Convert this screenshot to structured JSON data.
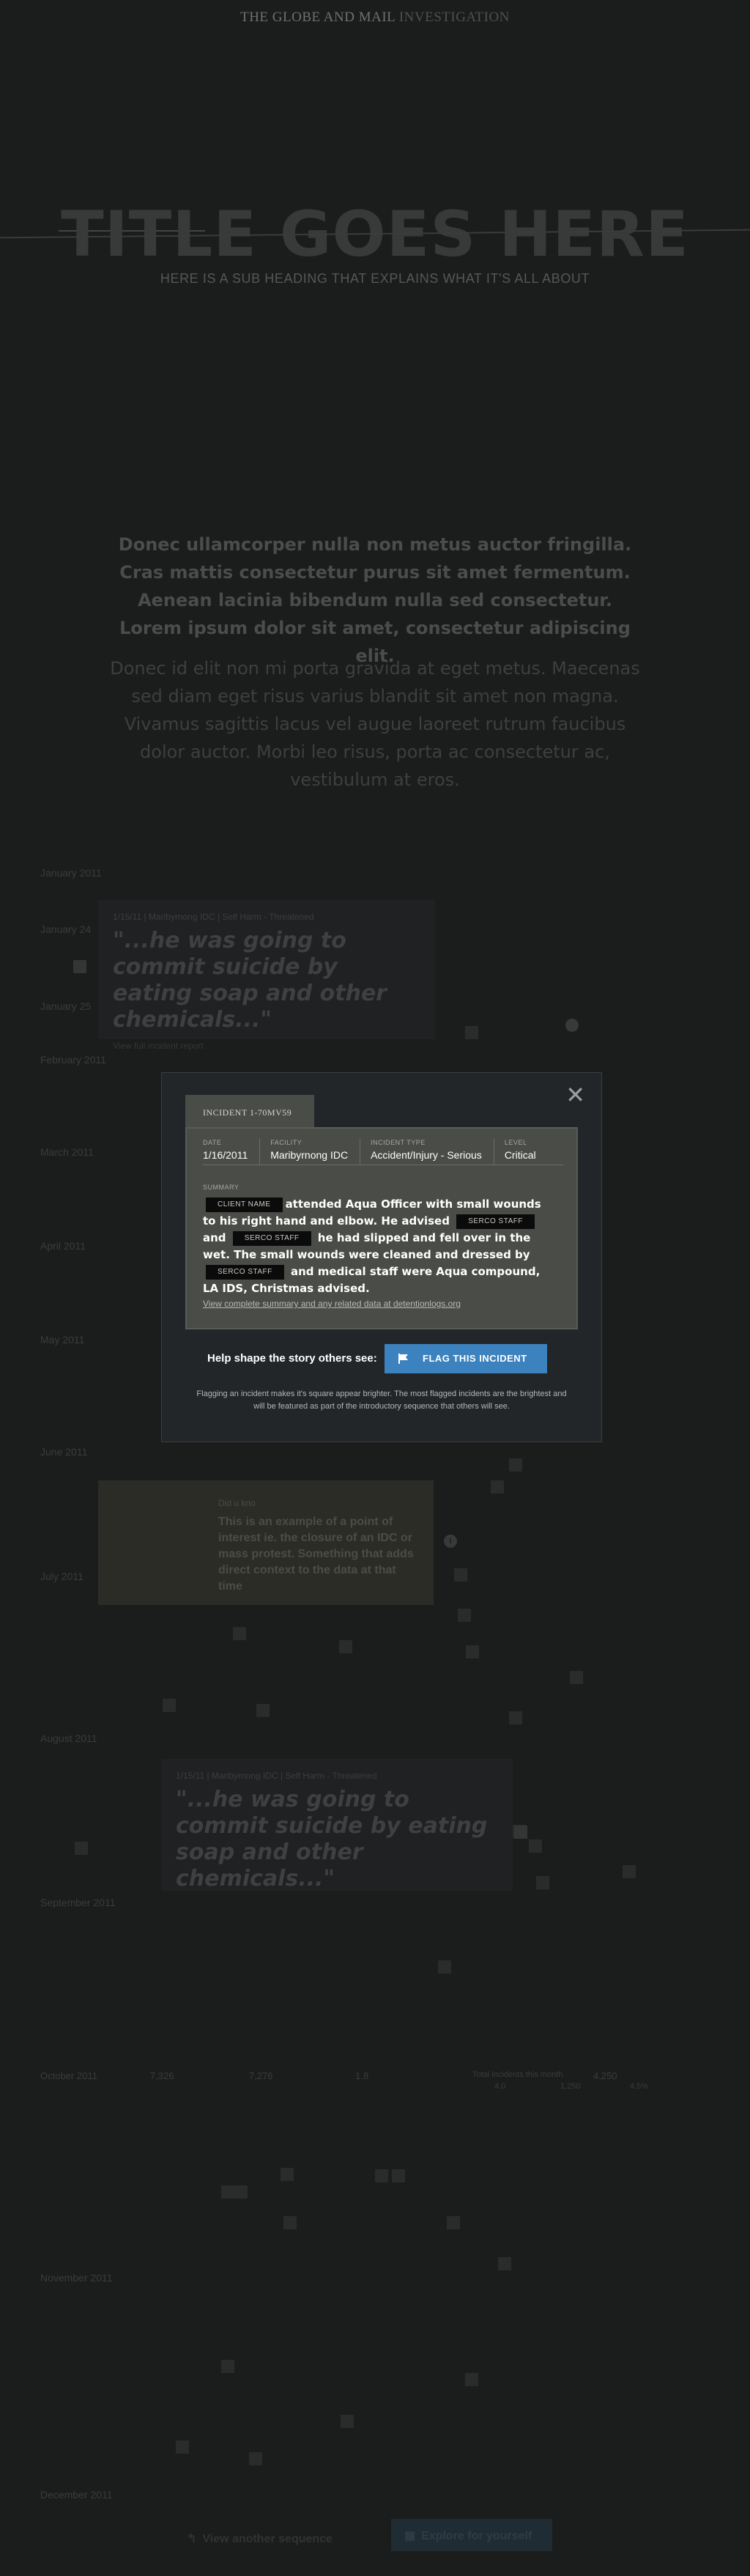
{
  "header": {
    "logo_main": "THE GLOBE AND MAIL",
    "logo_section": "INVESTIGATION",
    "title": "TITLE GOES HERE",
    "subtitle": "HERE IS A SUB HEADING THAT EXPLAINS WHAT IT'S ALL ABOUT"
  },
  "intro": {
    "bold": "Donec ullamcorper nulla non metus auctor fringilla. Cras mattis consectetur purus sit amet fermentum. Aenean lacinia bibendum nulla sed consectetur. Lorem ipsum dolor sit amet, consectetur adipiscing elit.",
    "light": "Donec id elit non mi porta gravida at eget metus. Maecenas sed diam eget risus varius blandit sit amet non magna. Vivamus sagittis lacus vel augue laoreet rutrum faucibus dolor auctor. Morbi leo risus, porta ac consectetur ac, vestibulum at eros."
  },
  "timeline": {
    "months": [
      "January 2011",
      "February 2011",
      "March 2011",
      "April 2011",
      "May 2011",
      "June 2011",
      "July 2011",
      "August 2011",
      "September 2011",
      "October 2011",
      "November 2011",
      "December 2011"
    ],
    "dates": [
      "January 24",
      "January 25"
    ],
    "card1": {
      "meta": "1/15/11 | Maribyrnong IDC | Self Harm - Threatened",
      "quote": "\"...he was going to commit suicide by eating soap and other chemicals...\"",
      "link": "View full incident report"
    },
    "card2": {
      "meta": "1/15/11 | Maribyrnong IDC | Self Harm - Threatened",
      "quote": "\"...he was going to commit suicide by eating soap and other chemicals...\""
    },
    "poi": {
      "tag": "Did u kno",
      "text": "This is an example of a point of interest ie. the closure of an IDC or mass protest. Something that adds direct context to the data at that time",
      "marker": "i"
    },
    "stats": {
      "month": "October 2011",
      "v1": "7,326",
      "v2": "7,276",
      "v3": "1.8",
      "note": "Total incidents this month",
      "v4": "4,250",
      "v5": "4.0",
      "v6": "1,250",
      "v7": "4.5%"
    }
  },
  "modal": {
    "close": "✕",
    "incident_id": "INCIDENT 1-70MV59",
    "fields": [
      {
        "label": "DATE",
        "value": "1/16/2011"
      },
      {
        "label": "FACILITY",
        "value": "Maribyrnong IDC"
      },
      {
        "label": "INCIDENT TYPE",
        "value": "Accident/Injury - Serious"
      },
      {
        "label": "LEVEL",
        "value": "Critical"
      }
    ],
    "summary_label": "SUMMARY",
    "summary": {
      "r1": "CLIENT NAME",
      "t1": "attended Aqua Officer with small wounds to his right hand and elbow. He advised",
      "r2": "SERCO STAFF",
      "t2": "and",
      "r3": "SERCO STAFF",
      "t3": "he had slipped and fell over in the wet. The small wounds were cleaned and dressed by",
      "r4": "SERCO STAFF",
      "t4": "and medical staff were Aqua compound, LA IDS, Christmas advised."
    },
    "view_link": "View complete summary and any related data at detentionlogs.org",
    "cta_label": "Help shape the story others see:",
    "flag_button": "FLAG THIS INCIDENT",
    "note": "Flagging an incident makes it's square appear brighter. The most flagged incidents are the brightest and will be featured as part of the introductory sequence that others will see."
  },
  "footer": {
    "back": "View another sequence",
    "explore": "Explore for yourself"
  }
}
